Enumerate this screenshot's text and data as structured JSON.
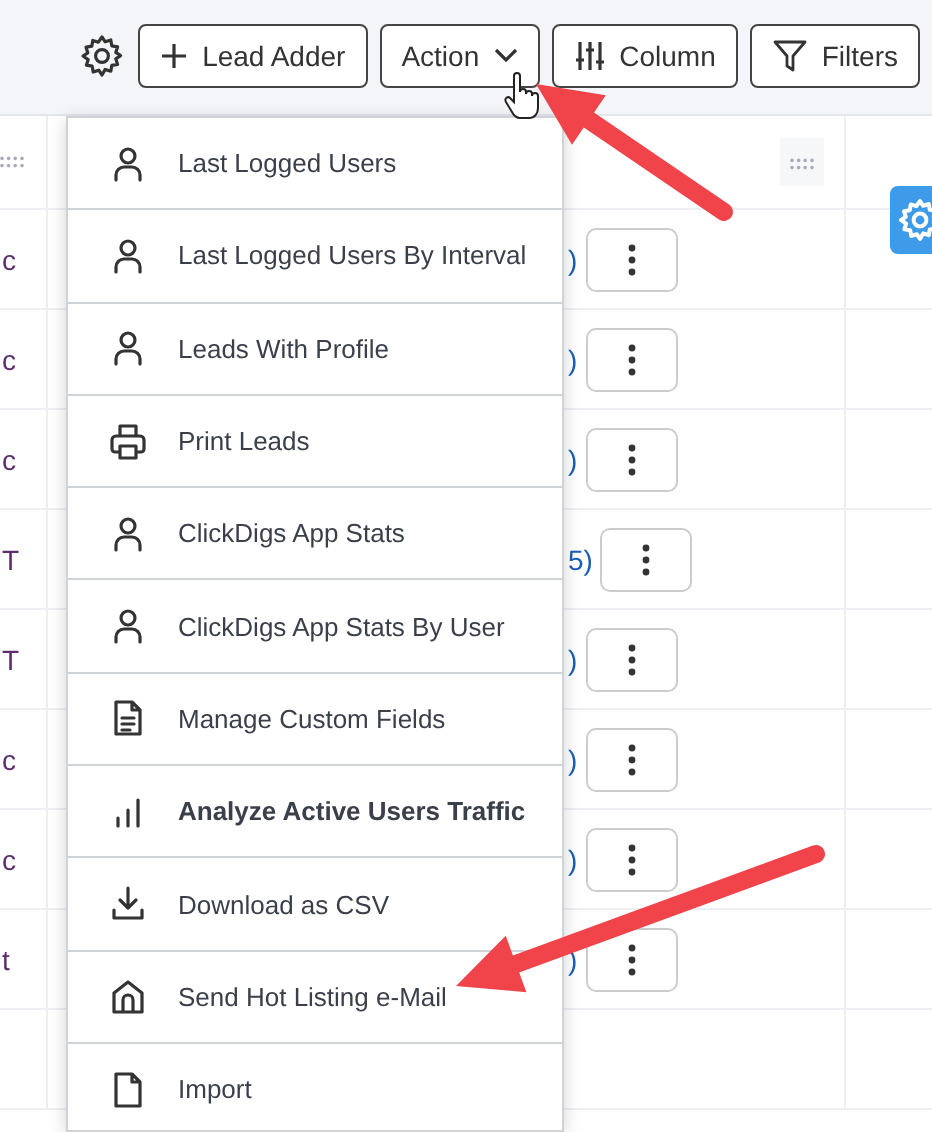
{
  "toolbar": [
    {
      "kind": "settings"
    },
    {
      "kind": "add",
      "label": "Lead Adder"
    },
    {
      "kind": "dropdown",
      "label": "Action"
    },
    {
      "kind": "columns",
      "label": "Column"
    },
    {
      "kind": "filter",
      "label": "Filters"
    }
  ],
  "table": {
    "rows": [
      {
        "column_1": "c",
        "column_2": ")"
      },
      {
        "column_1": "c",
        "column_2": ")"
      },
      {
        "column_1": "c",
        "column_2": ")"
      },
      {
        "column_1": "T",
        "column_2": "5)"
      },
      {
        "column_1": "T",
        "column_2": ")"
      },
      {
        "column_1": "c",
        "column_2": ")"
      },
      {
        "column_1": "c",
        "column_2": ")"
      },
      {
        "column_1": "t",
        "column_2": ")"
      }
    ]
  },
  "menu": {
    "items": [
      {
        "label": "Last Logged Users",
        "emphasized": false
      },
      {
        "label": "Last Logged Users By Interval",
        "emphasized": false
      },
      {
        "label": "Leads With Profile",
        "emphasized": false
      },
      {
        "label": "Print Leads",
        "emphasized": false
      },
      {
        "label": "ClickDigs App Stats",
        "emphasized": false
      },
      {
        "label": "ClickDigs App Stats By User",
        "emphasized": false
      },
      {
        "label": "Manage Custom Fields",
        "emphasized": false
      },
      {
        "label": "Analyze Active Users Traffic",
        "emphasized": true
      },
      {
        "label": "Download as CSV",
        "emphasized": false
      },
      {
        "label": "Send Hot Listing e-Mail",
        "emphasized": false
      },
      {
        "label": "Import",
        "emphasized": false
      }
    ]
  }
}
